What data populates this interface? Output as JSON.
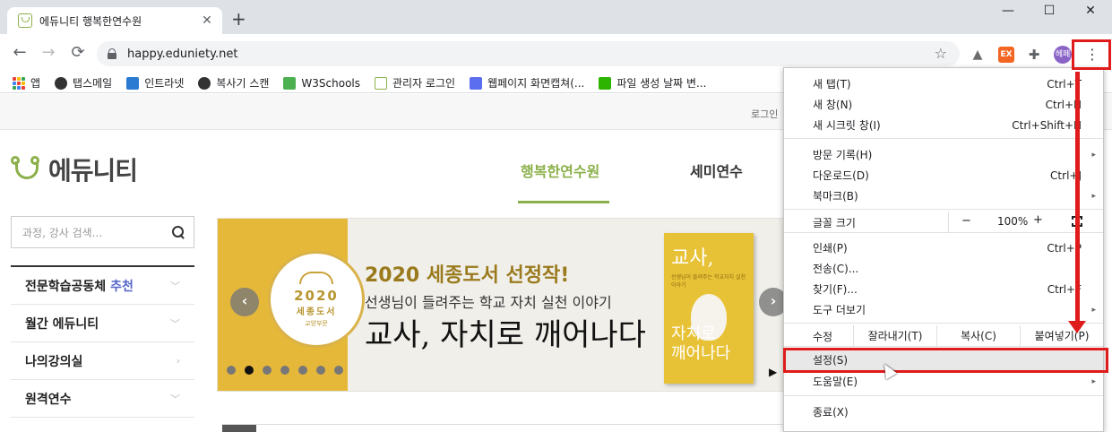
{
  "browser": {
    "tab_title": "에듀니티 행복한연수원",
    "tab_close": "✕",
    "new_tab": "+",
    "window_controls": {
      "minimize": "—",
      "maximize": "☐",
      "close": "✕"
    },
    "nav": {
      "back": "←",
      "forward": "→",
      "reload": "⟳"
    },
    "url": "happy.eduniety.net",
    "star": "☆",
    "extensions": [
      {
        "name": "drive",
        "text": "▲",
        "color": "#6c6c6c"
      },
      {
        "name": "ex",
        "text": "EX",
        "color": "#f26522"
      },
      {
        "name": "puzzle",
        "text": "✚",
        "color": "#5f6368"
      }
    ],
    "profile_label": "헤페",
    "menu_button": "⋮"
  },
  "bookmarks": [
    {
      "label": "앱",
      "icon": "apps-grid-icon"
    },
    {
      "label": "탭스메일",
      "icon": "globe-icon",
      "color": "#333333"
    },
    {
      "label": "인트라넷",
      "icon": "intranet-icon",
      "color": "#2a7bd1"
    },
    {
      "label": "복사기 스캔",
      "icon": "globe-icon",
      "color": "#333333"
    },
    {
      "label": "W3Schools",
      "icon": "w3-icon",
      "color": "#4caf50"
    },
    {
      "label": "관리자 로그인",
      "icon": "eduniety-icon",
      "color": "#8bb04a"
    },
    {
      "label": "웹페이지 화면캡쳐(...",
      "icon": "d-icon",
      "color": "#5b6ef0"
    },
    {
      "label": "파일 생성 날짜 변...",
      "icon": "blog-icon",
      "color": "#2db400"
    }
  ],
  "site": {
    "login": "로그인",
    "logo_text": "에듀니티",
    "gnb": [
      "행복한연수원",
      "세미연수"
    ],
    "search_placeholder": "과정, 강사 검색...",
    "lnb": [
      {
        "label": "전문학습공동체",
        "extra": "추천",
        "chevron": "﹀"
      },
      {
        "label": "월간 에듀니티",
        "extra": "",
        "chevron": "﹀"
      },
      {
        "label": "나의강의실",
        "extra": "",
        "chevron": "›"
      },
      {
        "label": "원격연수",
        "extra": "",
        "chevron": "﹀"
      }
    ],
    "banner": {
      "seal_year": "2020",
      "seal_name": "세종도서",
      "seal_sub": "교양부문",
      "headline": "2020 세종도서 선정작!",
      "subhead": "선생님이 들려주는 학교 자치 실천 이야기",
      "title": "교사, 자치로 깨어나다",
      "book_top": "교사,",
      "book_sub": "선생님이 들려주는 학교자치 실천 이야기",
      "book_bottom": "자치로\n깨어나다",
      "prev": "‹",
      "next": "›",
      "dots": 7,
      "active_dot": 1,
      "play": "▶"
    }
  },
  "menu": {
    "items": [
      {
        "label": "새 탭(T)",
        "shortcut": "Ctrl+T"
      },
      {
        "label": "새 창(N)",
        "shortcut": "Ctrl+N"
      },
      {
        "label": "새 시크릿 창(I)",
        "shortcut": "Ctrl+Shift+N"
      },
      {
        "label": "방문 기록(H)",
        "shortcut": "",
        "submenu": true
      },
      {
        "label": "다운로드(D)",
        "shortcut": "Ctrl+J"
      },
      {
        "label": "북마크(B)",
        "shortcut": "",
        "submenu": true
      },
      {
        "label": "인쇄(P)",
        "shortcut": "Ctrl+P"
      },
      {
        "label": "전송(C)...",
        "shortcut": ""
      },
      {
        "label": "찾기(F)...",
        "shortcut": "Ctrl+F"
      },
      {
        "label": "도구 더보기",
        "shortcut": "",
        "submenu": true
      },
      {
        "label": "설정(S)",
        "shortcut": ""
      },
      {
        "label": "도움말(E)",
        "shortcut": "",
        "submenu": true
      },
      {
        "label": "종료(X)",
        "shortcut": ""
      }
    ],
    "zoom": {
      "label": "글꼴 크기",
      "minus": "−",
      "value": "100%",
      "plus": "+"
    },
    "edit": {
      "label": "수정",
      "cut": "잘라내기(T)",
      "copy": "복사(C)",
      "paste": "붙여넣기(P)"
    },
    "submenu_arrow": "▸"
  },
  "colors": {
    "accent": "#8bb04a",
    "annotation": "#e01b1b"
  }
}
